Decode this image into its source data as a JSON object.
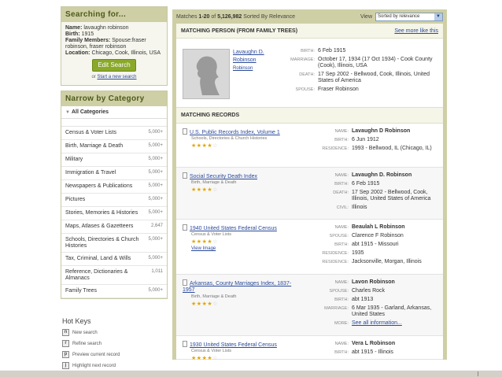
{
  "search": {
    "title": "Searching for...",
    "name_label": "Name:",
    "name_value": "lavaughn robinson",
    "birth_label": "Birth:",
    "birth_value": "1915",
    "family_label": "Family Members:",
    "family_value": "Spouse:fraser robinson, fraser robinson",
    "location_label": "Location:",
    "location_value": "Chicago, Cook, Illinois, USA",
    "edit_button": "Edit Search",
    "or_text": "or",
    "start_new": "Start a new search"
  },
  "narrow": {
    "title": "Narrow by Category",
    "all_categories": "All Categories",
    "categories": [
      {
        "name": "Census & Voter Lists",
        "count": "5,000+"
      },
      {
        "name": "Birth, Marriage & Death",
        "count": "5,000+"
      },
      {
        "name": "Military",
        "count": "5,000+"
      },
      {
        "name": "Immigration & Travel",
        "count": "5,000+"
      },
      {
        "name": "Newspapers & Publications",
        "count": "5,000+"
      },
      {
        "name": "Pictures",
        "count": "5,000+"
      },
      {
        "name": "Stories, Memories & Histories",
        "count": "5,000+"
      },
      {
        "name": "Maps, Atlases & Gazetteers",
        "count": "2,647"
      },
      {
        "name": "Schools, Directories & Church Histories",
        "count": "5,000+"
      },
      {
        "name": "Tax, Criminal, Land & Wills",
        "count": "5,000+"
      },
      {
        "name": "Reference, Dictionaries & Almanacs",
        "count": "1,011"
      },
      {
        "name": "Family Trees",
        "count": "5,000+"
      }
    ]
  },
  "hotkeys": {
    "title": "Hot Keys",
    "items": [
      {
        "key": "n",
        "label": "New search"
      },
      {
        "key": "r",
        "label": "Refine search"
      },
      {
        "key": "p",
        "label": "Preview current record"
      },
      {
        "key": "j",
        "label": "Highlight next record"
      }
    ]
  },
  "results": {
    "matches_prefix": "Matches",
    "range": "1-20",
    "of": "of",
    "total": "5,126,982",
    "sorted": "Sorted By Relevance",
    "view_label": "View",
    "sort_value": "Sorted by relevance"
  },
  "person": {
    "section_title": "MATCHING PERSON (FROM FAMILY TREES)",
    "see_more": "See more like this",
    "name": "Lavaughn D. Robinson",
    "sub": "Robinson",
    "facts": [
      {
        "k": "BIRTH:",
        "v": "6 Feb 1915"
      },
      {
        "k": "MARRIAGE:",
        "v": "October 17, 1934 (17 Oct 1934) - Cook County (Cook), Illinois, USA"
      },
      {
        "k": "DEATH:",
        "v": "17 Sep 2002 - Bellwood, Cook, Illinois, United States of America"
      },
      {
        "k": "SPOUSE:",
        "v": "Fraser Robinson"
      }
    ]
  },
  "records": {
    "section_title": "MATCHING RECORDS",
    "items": [
      {
        "title": "U.S. Public Records Index, Volume 1",
        "category": "Schools, Directories & Church Histories",
        "stars": 4,
        "facts": [
          {
            "k": "NAME:",
            "v": "Lavaughn D Robinson",
            "bold": true
          },
          {
            "k": "BIRTH:",
            "v": "6 Jun 1912"
          },
          {
            "k": "RESIDENCE:",
            "v": "1993 - Bellwood, IL (Chicago, IL)"
          }
        ]
      },
      {
        "title": "Social Security Death Index",
        "category": "Birth, Marriage & Death",
        "stars": 3.5,
        "facts": [
          {
            "k": "NAME:",
            "v": "Lavaughn D. Robinson",
            "bold": true
          },
          {
            "k": "BIRTH:",
            "v": "6 Feb 1915"
          },
          {
            "k": "DEATH:",
            "v": "17 Sep 2002 - Bellwood, Cook, Illinois, United States of America"
          },
          {
            "k": "CIVIL:",
            "v": "Illinois"
          }
        ]
      },
      {
        "title": "1940 United States Federal Census",
        "category": "Census & Voter Lists",
        "stars": 3.5,
        "view_image": "View Image",
        "facts": [
          {
            "k": "NAME:",
            "v": "Beaulah L Robinson",
            "bold": true
          },
          {
            "k": "SPOUSE:",
            "v": "Clarence F Robinson"
          },
          {
            "k": "BIRTH:",
            "v": "abt 1915 - Missouri"
          },
          {
            "k": "RESIDENCE:",
            "v": "1935"
          },
          {
            "k": "RESIDENCE:",
            "v": "Jacksonville, Morgan, Illinois"
          }
        ]
      },
      {
        "title": "Arkansas, County Marriages Index, 1837-1957",
        "category": "Birth, Marriage & Death",
        "stars": 3.5,
        "facts": [
          {
            "k": "NAME:",
            "v": "Lavon Robinson",
            "bold": true
          },
          {
            "k": "SPOUSE:",
            "v": "Charles Rock"
          },
          {
            "k": "BIRTH:",
            "v": "abt 1913"
          },
          {
            "k": "MARRIAGE:",
            "v": "6 Mar 1935 - Garland, Arkansas, United States"
          },
          {
            "k": "MORE:",
            "v": "See all information...",
            "link": true
          }
        ]
      },
      {
        "title": "1930 United States Federal Census",
        "category": "Census & Voter Lists",
        "stars": 3.5,
        "facts": [
          {
            "k": "NAME:",
            "v": "Vera L Robinson",
            "bold": true
          },
          {
            "k": "BIRTH:",
            "v": "abt 1915 - Illinois"
          }
        ]
      }
    ]
  }
}
